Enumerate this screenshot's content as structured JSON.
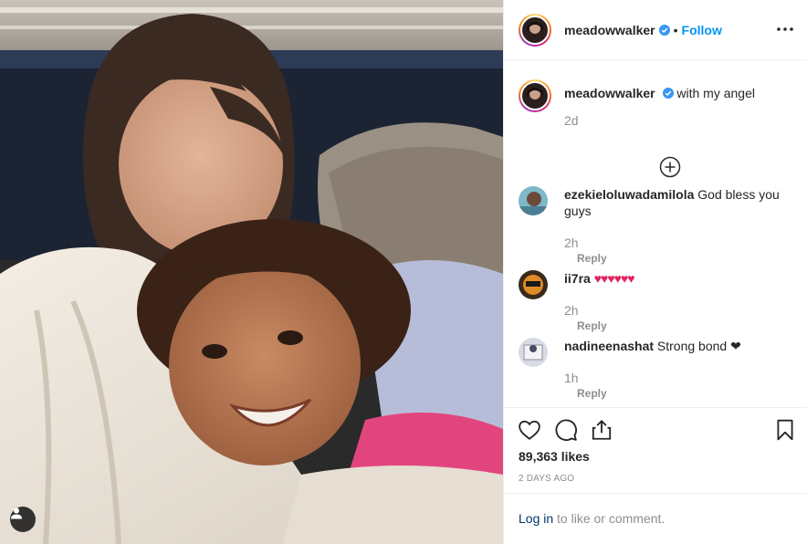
{
  "post": {
    "username": "meadowwalker",
    "follow_label": "Follow",
    "dot": "•",
    "caption_text": "with my angel",
    "caption_age": "2d",
    "likes": "89,363 likes",
    "timestamp": "2 DAYS AGO"
  },
  "comments": [
    {
      "username": "ezekieloluwadamilola",
      "text": "God bless you guys",
      "age": "2h",
      "reply_label": "Reply"
    },
    {
      "username": "ii7ra",
      "text": "♥♥♥♥♥♥",
      "age": "2h",
      "reply_label": "Reply"
    },
    {
      "username": "nadineenashat",
      "text": "Strong bond ❤",
      "age": "1h",
      "reply_label": "Reply"
    }
  ],
  "login": {
    "link_label": "Log in",
    "rest_text": " to like or comment."
  },
  "colors": {
    "accent": "#0095f6",
    "verified": "#3897f0",
    "heart_red": "#e0245e",
    "muted": "#8e8e8e"
  },
  "icons": [
    "more-options-icon",
    "verified-badge-icon",
    "plus-circle-icon",
    "heart-icon",
    "comment-icon",
    "share-icon",
    "bookmark-icon",
    "user-tag-icon"
  ]
}
